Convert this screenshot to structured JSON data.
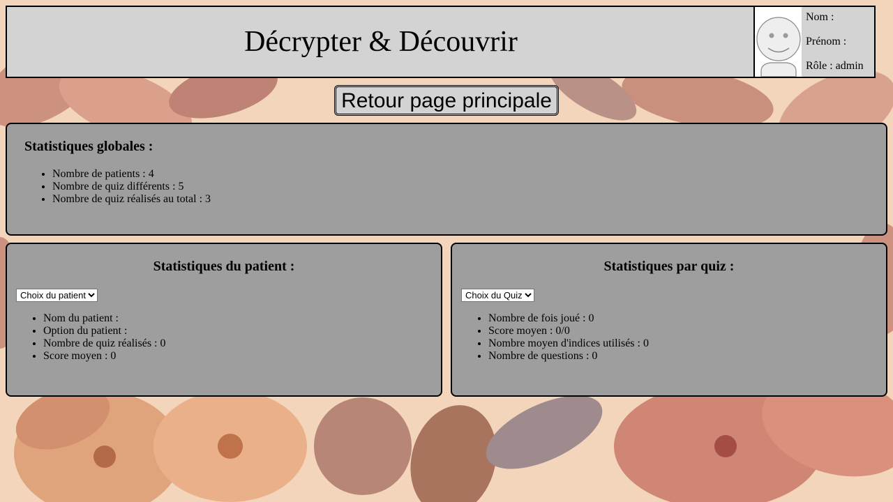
{
  "header": {
    "title": "Décrypter & Découvrir"
  },
  "user": {
    "nom": "Nom :",
    "prenom": "Prénom :",
    "role": "Rôle : admin"
  },
  "back_button": {
    "label": "Retour page principale"
  },
  "global_stats": {
    "title": "Statistiques globales :",
    "items": [
      "Nombre de patients : 4",
      "Nombre de quiz différents : 5",
      "Nombre de quiz réalisés au total : 3"
    ]
  },
  "patient_stats": {
    "title": "Statistiques du patient :",
    "select_value": "Choix du patient",
    "items": [
      "Nom du patient :",
      "Option du patient :",
      "Nombre de quiz réalisés : 0",
      "Score moyen : 0"
    ]
  },
  "quiz_stats": {
    "title": "Statistiques par quiz :",
    "select_value": "Choix du Quiz",
    "items": [
      "Nombre de fois joué : 0",
      "Score moyen : 0/0",
      "Nombre moyen d'indices utilisés : 0",
      "Nombre de questions : 0"
    ]
  }
}
